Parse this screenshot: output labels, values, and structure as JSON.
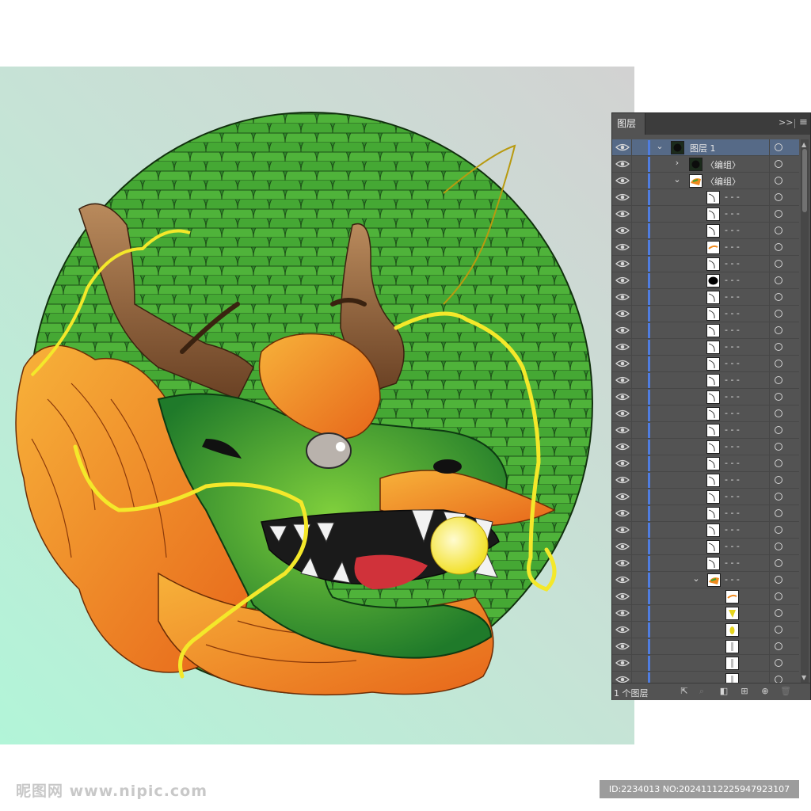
{
  "panel": {
    "tab_label": "图层",
    "collapse_label": ">>",
    "menu_label": "≡",
    "layer_count": "1 个图层"
  },
  "layers": {
    "top_layer_name": "图层 1",
    "group_name_1": "〈编组〉",
    "group_name_2": "〈编组〉",
    "path_label": "- - -"
  },
  "footer_icons": [
    "export-icon",
    "search-icon",
    "clip-mask-icon",
    "new-sublayer-icon",
    "new-layer-icon",
    "delete-icon"
  ],
  "watermark": {
    "site": "昵图网 www.nipic.com",
    "id_text": "ID:2234013 NO:20241112225947923107"
  },
  "colors": {
    "scale_green": "#3fa12e",
    "mane_orange": "#f08a1e",
    "whisker_yellow": "#f4e82a",
    "antler_brown": "#8a5a32",
    "selected_row": "#566a87",
    "color_bar": "#4f7de0"
  }
}
